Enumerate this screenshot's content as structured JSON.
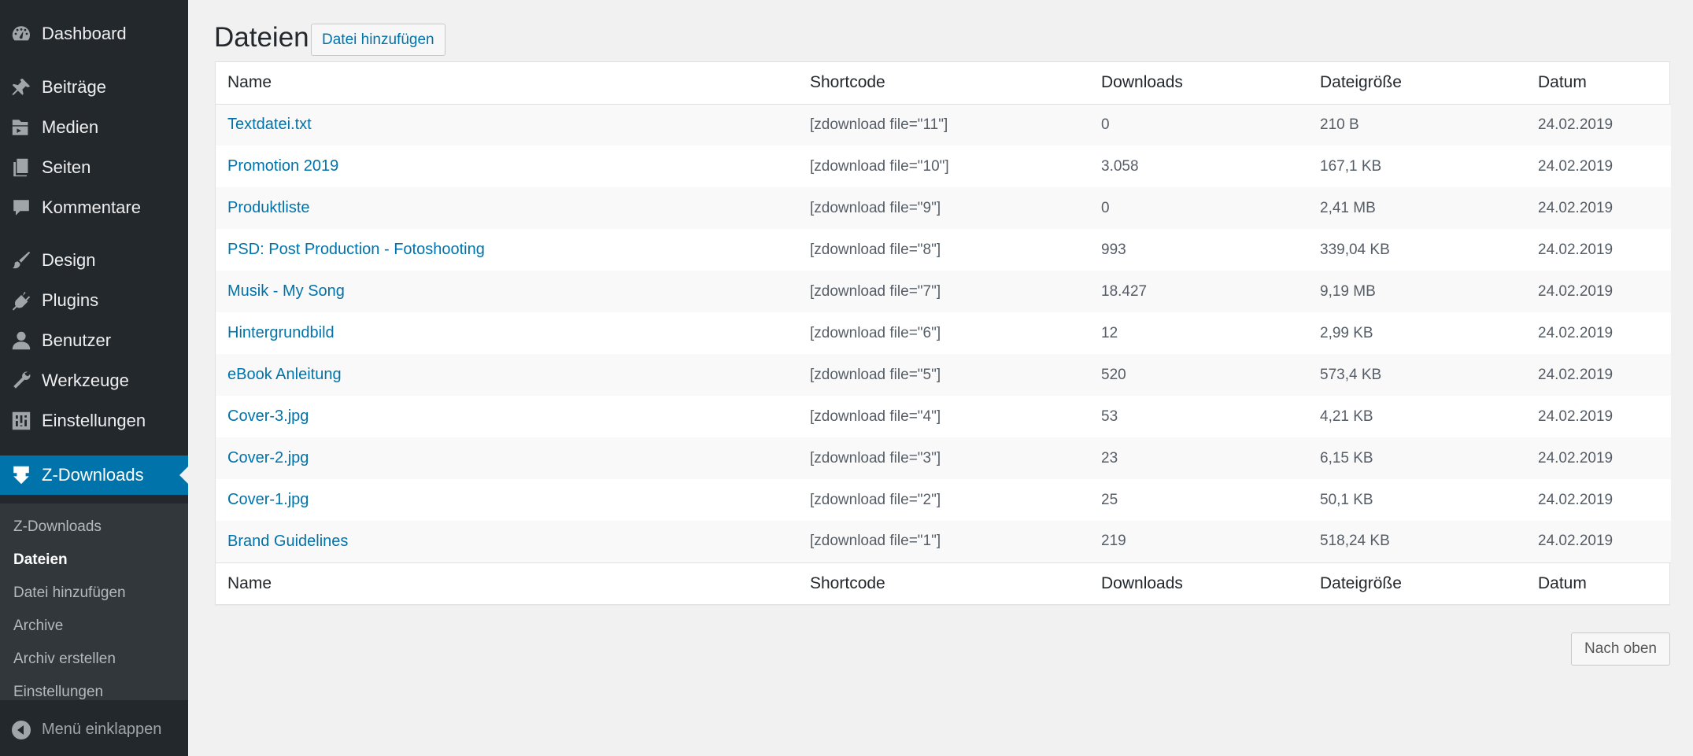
{
  "sidebar": {
    "items": [
      {
        "label": "Dashboard",
        "icon": "dashboard-icon"
      },
      {
        "label": "Beiträge",
        "icon": "pin-icon"
      },
      {
        "label": "Medien",
        "icon": "media-icon"
      },
      {
        "label": "Seiten",
        "icon": "pages-icon"
      },
      {
        "label": "Kommentare",
        "icon": "comment-icon"
      },
      {
        "label": "Design",
        "icon": "brush-icon"
      },
      {
        "label": "Plugins",
        "icon": "plugin-icon"
      },
      {
        "label": "Benutzer",
        "icon": "user-icon"
      },
      {
        "label": "Werkzeuge",
        "icon": "wrench-icon"
      },
      {
        "label": "Einstellungen",
        "icon": "settings-icon"
      },
      {
        "label": "Z-Downloads",
        "icon": "download-icon"
      }
    ],
    "submenu": [
      {
        "label": "Z-Downloads"
      },
      {
        "label": "Dateien"
      },
      {
        "label": "Datei hinzufügen"
      },
      {
        "label": "Archive"
      },
      {
        "label": "Archiv erstellen"
      },
      {
        "label": "Einstellungen"
      }
    ],
    "collapse_label": "Menü einklappen"
  },
  "main": {
    "title": "Dateien",
    "add_button": "Datei hinzufügen",
    "columns": [
      "Name",
      "Shortcode",
      "Downloads",
      "Dateigröße",
      "Datum"
    ],
    "rows": [
      {
        "name": "Textdatei.txt",
        "shortcode": "[zdownload file=\"11\"]",
        "downloads": "0",
        "size": "210 B",
        "date": "24.02.2019"
      },
      {
        "name": "Promotion 2019",
        "shortcode": "[zdownload file=\"10\"]",
        "downloads": "3.058",
        "size": "167,1 KB",
        "date": "24.02.2019"
      },
      {
        "name": "Produktliste",
        "shortcode": "[zdownload file=\"9\"]",
        "downloads": "0",
        "size": "2,41 MB",
        "date": "24.02.2019"
      },
      {
        "name": "PSD: Post Production - Fotoshooting",
        "shortcode": "[zdownload file=\"8\"]",
        "downloads": "993",
        "size": "339,04 KB",
        "date": "24.02.2019"
      },
      {
        "name": "Musik - My Song",
        "shortcode": "[zdownload file=\"7\"]",
        "downloads": "18.427",
        "size": "9,19 MB",
        "date": "24.02.2019"
      },
      {
        "name": "Hintergrundbild",
        "shortcode": "[zdownload file=\"6\"]",
        "downloads": "12",
        "size": "2,99 KB",
        "date": "24.02.2019"
      },
      {
        "name": "eBook Anleitung",
        "shortcode": "[zdownload file=\"5\"]",
        "downloads": "520",
        "size": "573,4 KB",
        "date": "24.02.2019"
      },
      {
        "name": "Cover-3.jpg",
        "shortcode": "[zdownload file=\"4\"]",
        "downloads": "53",
        "size": "4,21 KB",
        "date": "24.02.2019"
      },
      {
        "name": "Cover-2.jpg",
        "shortcode": "[zdownload file=\"3\"]",
        "downloads": "23",
        "size": "6,15 KB",
        "date": "24.02.2019"
      },
      {
        "name": "Cover-1.jpg",
        "shortcode": "[zdownload file=\"2\"]",
        "downloads": "25",
        "size": "50,1 KB",
        "date": "24.02.2019"
      },
      {
        "name": "Brand Guidelines",
        "shortcode": "[zdownload file=\"1\"]",
        "downloads": "219",
        "size": "518,24 KB",
        "date": "24.02.2019"
      }
    ],
    "top_button": "Nach oben"
  },
  "colors": {
    "sidebar_bg": "#23282d",
    "submenu_bg": "#32373c",
    "accent": "#0073aa",
    "page_bg": "#f1f1f1"
  }
}
